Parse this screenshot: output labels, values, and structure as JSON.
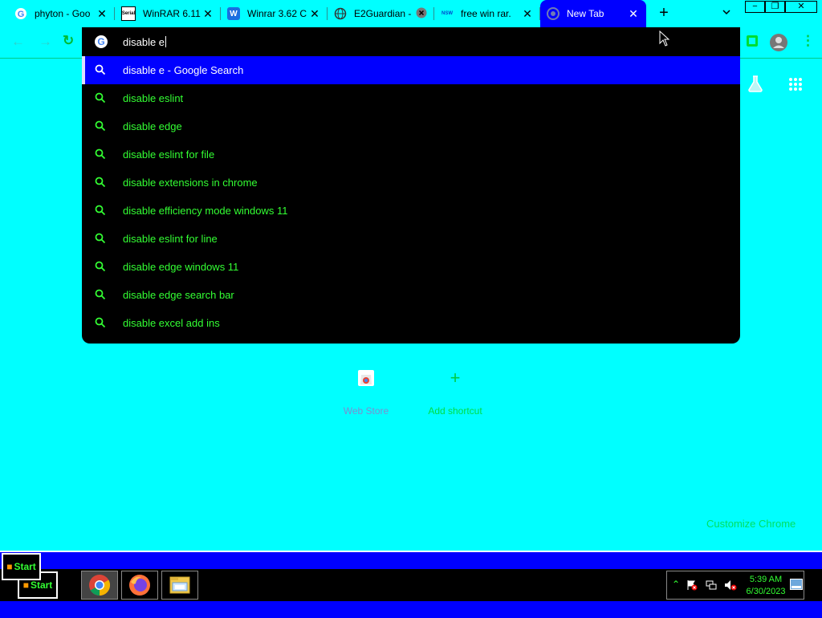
{
  "tabs": [
    {
      "title": "phyton - Goo",
      "favicon": "google-icon"
    },
    {
      "title": "WinRAR 6.11",
      "favicon": "serial-icon",
      "favicon_text": "Serial"
    },
    {
      "title": "Winrar 3.62 C",
      "favicon": "w-icon",
      "favicon_text": "W"
    },
    {
      "title": "E2Guardian -",
      "favicon": "globe-icon"
    },
    {
      "title": "free win rar. ",
      "favicon": "nsw-icon",
      "favicon_text": "NSW"
    },
    {
      "title": "New Tab",
      "favicon": "chrome-icon",
      "active": true
    }
  ],
  "tab_close_glyph": "✕",
  "new_tab_glyph": "+",
  "tab_search_glyph": "⌄",
  "window_controls": {
    "minimize": "−",
    "restore": "❐",
    "close": "✕"
  },
  "toolbar": {
    "back_glyph": "←",
    "forward_glyph": "→",
    "reload_glyph": "↻",
    "menu_glyph": "⋮"
  },
  "omnibox": {
    "query": "disable e",
    "suggestions": [
      "disable e - Google Search",
      "disable eslint",
      "disable edge",
      "disable eslint for file",
      "disable extensions in chrome",
      "disable efficiency mode windows 11",
      "disable eslint for line",
      "disable edge windows 11",
      "disable edge search bar",
      "disable excel add ins"
    ],
    "selected_index": 0
  },
  "ntp": {
    "shortcuts": [
      {
        "label": "Web Store",
        "icon": "web-store-icon"
      },
      {
        "label": "Add shortcut",
        "icon": "plus-icon",
        "glyph": "+"
      }
    ],
    "customize_label": "Customize Chrome"
  },
  "taskbar": {
    "start_label": "Start",
    "apps": [
      "chrome-icon",
      "firefox-icon",
      "file-manager-icon"
    ],
    "tray_up_glyph": "⌃",
    "clock_time": "5:39 AM",
    "clock_date": "6/30/2023"
  },
  "colors": {
    "background": "#00ffff",
    "accent": "#0000ff",
    "suggestion_text": "#33ff33",
    "dropdown_bg": "#000000"
  }
}
